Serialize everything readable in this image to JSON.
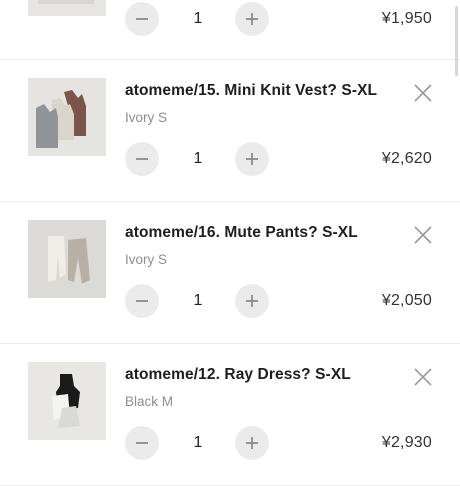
{
  "cart": {
    "items": [
      {
        "name": "",
        "variant": "",
        "quantity": "1",
        "price": "¥1,950",
        "thumb_icon": "product-photo"
      },
      {
        "name": "atomeme/15. Mini Knit Vest? S-XL",
        "variant": "Ivory S",
        "quantity": "1",
        "price": "¥2,620",
        "thumb_icon": "knit-vest-photo"
      },
      {
        "name": "atomeme/16. Mute Pants? S-XL",
        "variant": "Ivory S",
        "quantity": "1",
        "price": "¥2,050",
        "thumb_icon": "pants-photo"
      },
      {
        "name": "atomeme/12. Ray Dress? S-XL",
        "variant": "Black M",
        "quantity": "1",
        "price": "¥2,930",
        "thumb_icon": "dress-photo"
      }
    ]
  },
  "colors": {
    "background": "#ffffff",
    "divider": "#ececec",
    "stepper_bg": "#ebebeb",
    "variant_text": "#8e8e8e",
    "icon": "#9a9a9a"
  }
}
